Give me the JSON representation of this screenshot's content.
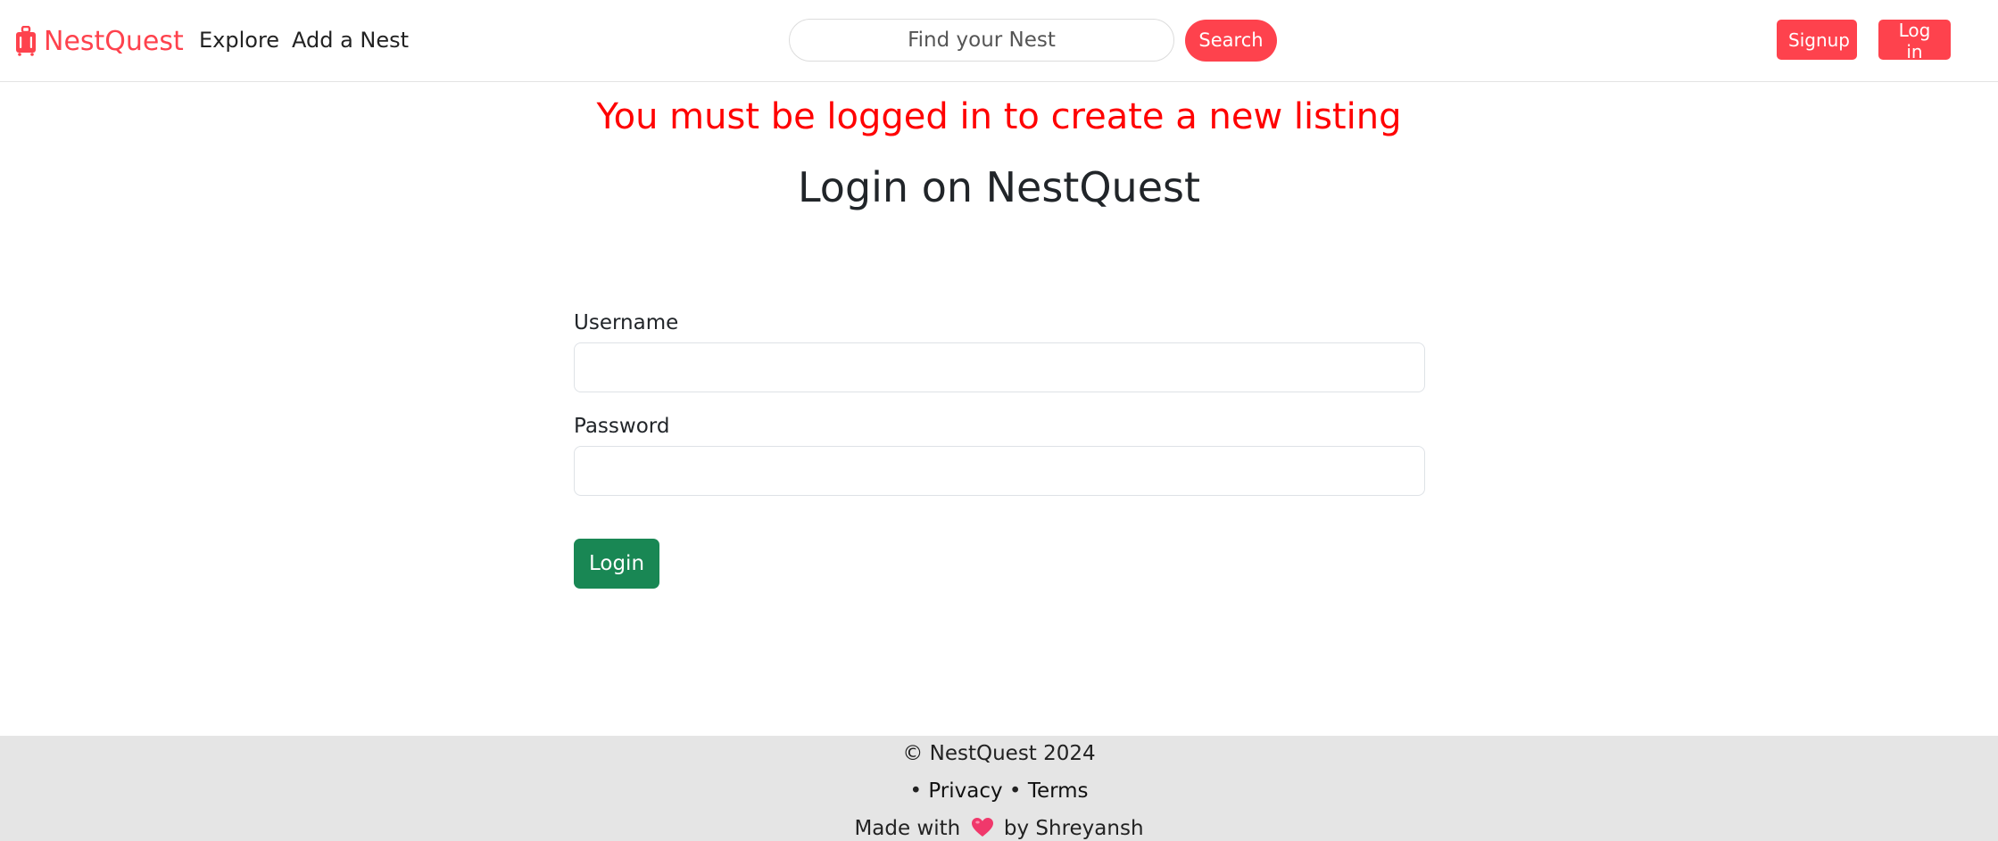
{
  "navbar": {
    "brand": "NestQuest",
    "brand_icon": "suitcase-icon",
    "brand_color": "#fe424d",
    "links": [
      {
        "label": "Explore"
      },
      {
        "label": "Add a Nest"
      }
    ],
    "search": {
      "placeholder": "Find your Nest",
      "button_label": "Search"
    },
    "signup_label": "Signup",
    "login_label": "Log in"
  },
  "flash": {
    "message": "You must be logged in to create a new listing",
    "color": "#ff0000"
  },
  "main": {
    "title": "Login on NestQuest",
    "form": {
      "username_label": "Username",
      "username_value": "",
      "password_label": "Password",
      "password_value": "",
      "submit_label": "Login",
      "submit_color": "#198754"
    }
  },
  "footer": {
    "copyright": "© NestQuest 2024",
    "bullet": "•",
    "privacy_label": "Privacy",
    "terms_label": "Terms",
    "made_with": "Made with",
    "heart_icon": "heart-icon",
    "by_author": "by Shreyansh"
  }
}
